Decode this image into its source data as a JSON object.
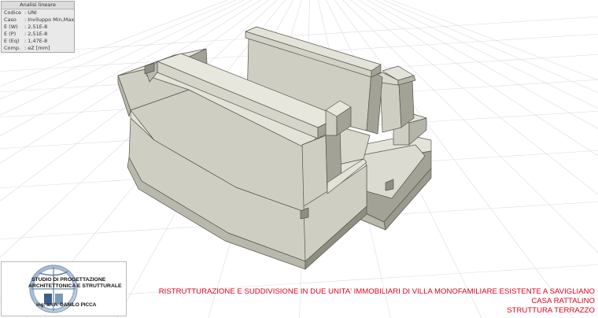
{
  "info_panel": {
    "title": "Analisi lineare",
    "rows": [
      {
        "key": "Codice",
        "value": ": UNI"
      },
      {
        "key": "Caso",
        "value": ": Inviluppo Min,Max"
      },
      {
        "key": "E (W)",
        "value": ": 2,51E-8"
      },
      {
        "key": "E (P)",
        "value": ": 2,51E-8"
      },
      {
        "key": "E (Eq)",
        "value": ": 1,47E-8"
      },
      {
        "key": "Comp.",
        "value": ": eZ [mm]"
      }
    ]
  },
  "logo": {
    "line1": "STUDIO DI PROGETTAZIONE",
    "line2": "ARCHITETTONICA E STRUTTURALE",
    "line3": "ing. arch. DANILO PICCA"
  },
  "title_block": {
    "line1": "RISTRUTTURAZIONE E SUDDIVISIONE IN DUE UNITA' IMMOBILIARI DI VILLA MONOFAMILIARE ESISTENTE A SAVIGLIANO",
    "line2": "CASA RATTALINO",
    "line3": "STRUTTURA TERRAZZO"
  },
  "colors": {
    "model_top": "#e4e3da",
    "model_light": "#cfcec2",
    "model_dark": "#a3a296",
    "model_edge": "#55554e",
    "title_red": "#e0001b",
    "grid": "#dcdcdc"
  }
}
